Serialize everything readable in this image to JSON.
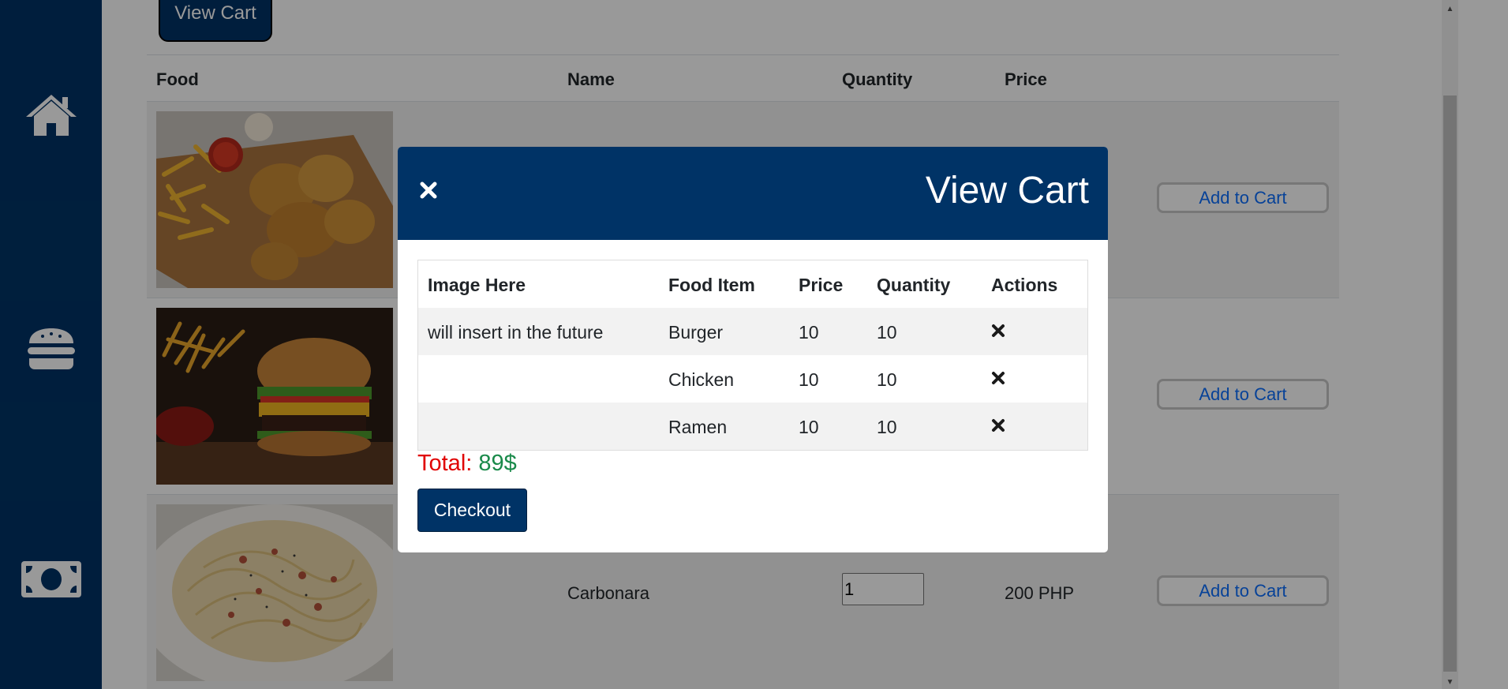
{
  "header": {
    "view_cart_label": "View Cart"
  },
  "sidebar": {
    "items": [
      {
        "icon": "home-icon"
      },
      {
        "icon": "burger-icon"
      },
      {
        "icon": "money-icon"
      }
    ]
  },
  "menu": {
    "columns": [
      "Food",
      "Name",
      "Quantity",
      "Price"
    ],
    "add_label": "Add to Cart",
    "rows": [
      {
        "image": "fried chicken and fries",
        "name": "",
        "quantity": "",
        "price": ""
      },
      {
        "image": "burger and fries",
        "name": "",
        "quantity": "",
        "price": ""
      },
      {
        "image": "carbonara",
        "name": "Carbonara",
        "quantity": "1",
        "price": "200 PHP"
      }
    ]
  },
  "modal": {
    "title": "View Cart",
    "close_icon": "close-icon",
    "columns": [
      "Image Here",
      "Food Item",
      "Price",
      "Quantity",
      "Actions"
    ],
    "rows": [
      {
        "image": "will insert in the future",
        "item": "Burger",
        "price": "10",
        "quantity": "10"
      },
      {
        "image": "",
        "item": "Chicken",
        "price": "10",
        "quantity": "10"
      },
      {
        "image": "",
        "item": "Ramen",
        "price": "10",
        "quantity": "10"
      }
    ],
    "total_label": "Total:",
    "total_value": "89$",
    "checkout_label": "Checkout"
  },
  "colors": {
    "sidebar": "#003366",
    "primary": "#003366",
    "link": "#0d6efd",
    "total_label": "#e00000",
    "total_value": "#1a8a4a"
  }
}
